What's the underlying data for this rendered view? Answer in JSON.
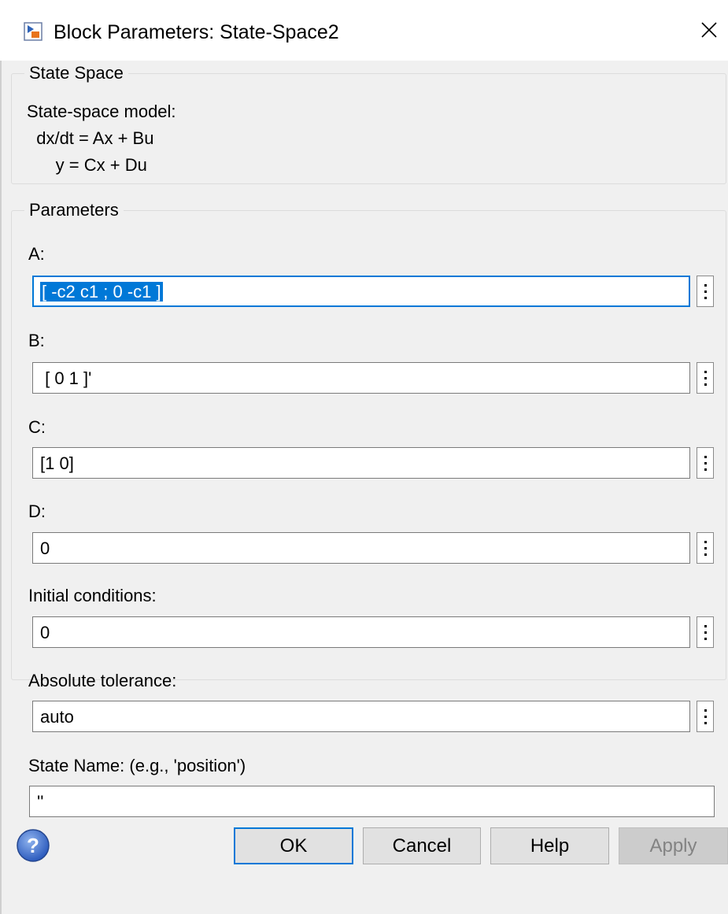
{
  "titlebar": {
    "title": "Block Parameters: State-Space2",
    "close_glyph": "×"
  },
  "description": {
    "legend": "State Space",
    "lines": [
      "State-space model:",
      "  dx/dt = Ax + Bu",
      "      y = Cx + Du"
    ]
  },
  "parameters": {
    "legend": "Parameters",
    "fields": [
      {
        "label": "A:",
        "value": "[ -c2 c1 ; 0 -c1 ]",
        "focused": true,
        "selected": true
      },
      {
        "label": "B:",
        "value": " [ 0 1 ]'"
      },
      {
        "label": "C:",
        "value": "[1 0]"
      },
      {
        "label": "D:",
        "value": "0"
      },
      {
        "label": "Initial conditions:",
        "value": "0"
      },
      {
        "label": "Absolute tolerance:",
        "value": "auto"
      },
      {
        "label": "State Name: (e.g., 'position')",
        "value": "''"
      }
    ]
  },
  "buttons": {
    "ok": "OK",
    "cancel": "Cancel",
    "help": "Help",
    "apply": "Apply"
  },
  "colors": {
    "accent": "#0078d7",
    "background": "#f0f0f0",
    "help_icon": "#3a6fcf"
  },
  "icons": {
    "title": "simulink-block-icon",
    "help": "question-circle-icon",
    "field_menu": "vertical-ellipsis-icon"
  }
}
